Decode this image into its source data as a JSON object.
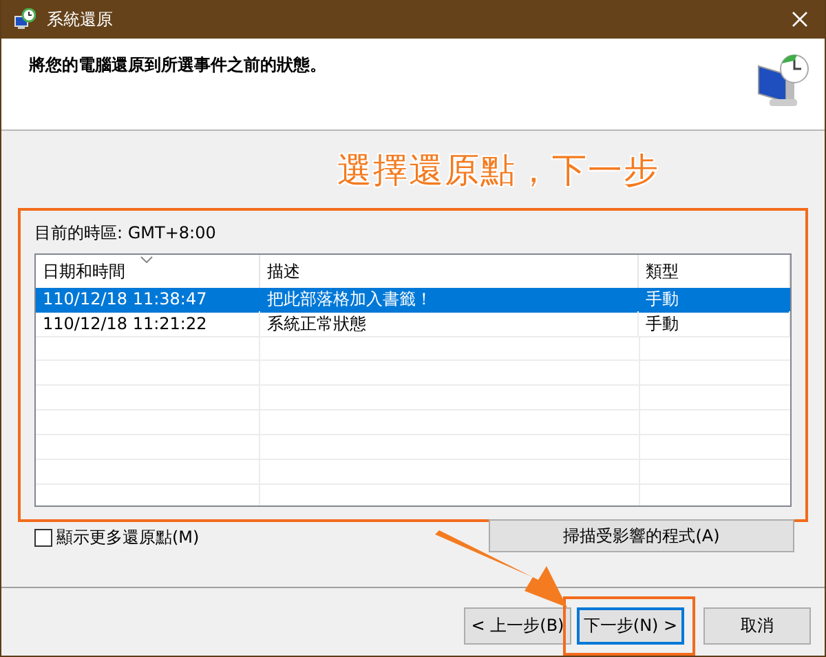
{
  "window": {
    "title": "系統還原"
  },
  "header": {
    "instruction": "將您的電腦還原到所選事件之前的狀態。"
  },
  "annotation": {
    "callout": "選擇還原點，下一步"
  },
  "time_zone": "目前的時區: GMT+8:00",
  "table": {
    "columns": [
      {
        "label": "日期和時間",
        "sorted": true
      },
      {
        "label": "描述",
        "sorted": false
      },
      {
        "label": "類型",
        "sorted": false
      }
    ],
    "rows": [
      {
        "cells": [
          "110/12/18 11:38:47",
          "把此部落格加入書籤！",
          "手動"
        ],
        "selected": true
      },
      {
        "cells": [
          "110/12/18 11:21:22",
          "系統正常狀態",
          "手動"
        ],
        "selected": false
      }
    ]
  },
  "show_more": {
    "label": "顯示更多還原點(M)",
    "checked": false
  },
  "scan_button": {
    "label": "掃描受影響的程式(A)"
  },
  "buttons": [
    {
      "label": "< 上一步(B)",
      "default": false,
      "highlighted": false
    },
    {
      "label": "下一步(N) >",
      "default": true,
      "highlighted": true
    },
    {
      "label": "取消",
      "default": false,
      "highlighted": false
    }
  ]
}
